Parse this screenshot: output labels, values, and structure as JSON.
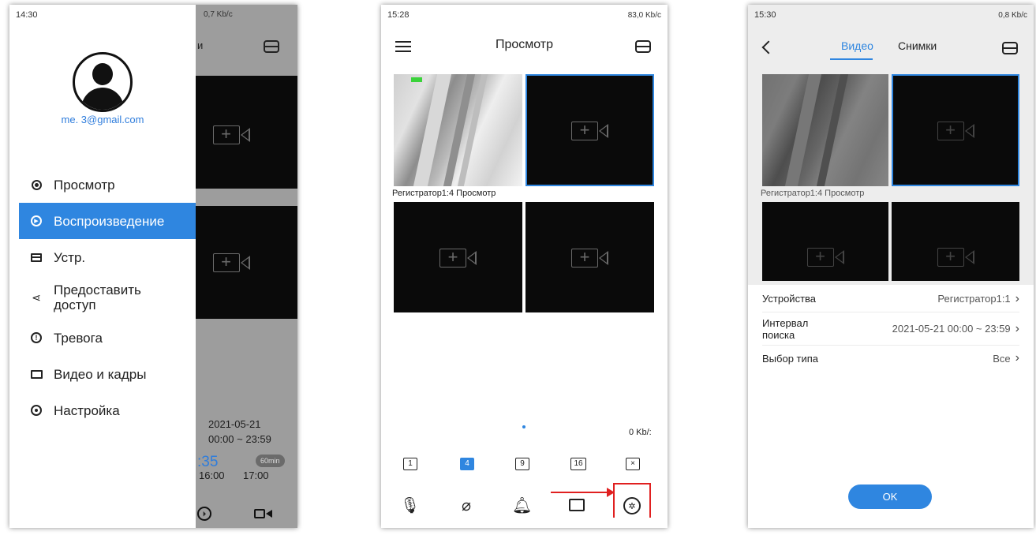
{
  "screen1": {
    "status_time": "14:30",
    "status_right": "0,7 Kb/c",
    "email": "me.         3@gmail.com",
    "menu": [
      {
        "label": "Просмотр",
        "icon": "camera-icon"
      },
      {
        "label": "Воспроизведение",
        "icon": "play-icon",
        "active": true
      },
      {
        "label": "Устр.",
        "icon": "device-icon"
      },
      {
        "label": "Предоставить доступ",
        "icon": "share-icon"
      },
      {
        "label": "Тревога",
        "icon": "alarm-icon"
      },
      {
        "label": "Видео и кадры",
        "icon": "folder-icon"
      },
      {
        "label": "Настройка",
        "icon": "settings-icon"
      }
    ],
    "bg_header_fragment": "и",
    "bg_date": "2021-05-21",
    "bg_time_range": "00:00 ~ 23:59",
    "bg_time_big": ":35",
    "bg_badge": "60min",
    "bg_tick1": "16:00",
    "bg_tick2": "17:00"
  },
  "screen2": {
    "status_time": "15:28",
    "status_right": "83,0 Kb/c",
    "title": "Просмотр",
    "channel_caption": "Регистратор1:4  Просмотр",
    "data_rate": "0 Kb/:",
    "layouts": [
      "1",
      "4",
      "9",
      "16",
      "×"
    ],
    "accent": "#2f86e0",
    "annotation_color": "#e02020"
  },
  "screen3": {
    "status_time": "15:30",
    "status_right": "0,8 Kb/c",
    "tab_video": "Видео",
    "tab_snapshots": "Снимки",
    "channel_caption": "Регистратор1:4  Просмотр",
    "rows": [
      {
        "label": "Устройства",
        "value": "Регистратор1:1"
      },
      {
        "label": "Интервал поиска",
        "value": "2021-05-21 00:00 ~ 23:59"
      },
      {
        "label": "Выбор типа",
        "value": "Все"
      }
    ],
    "ok_label": "OK"
  }
}
